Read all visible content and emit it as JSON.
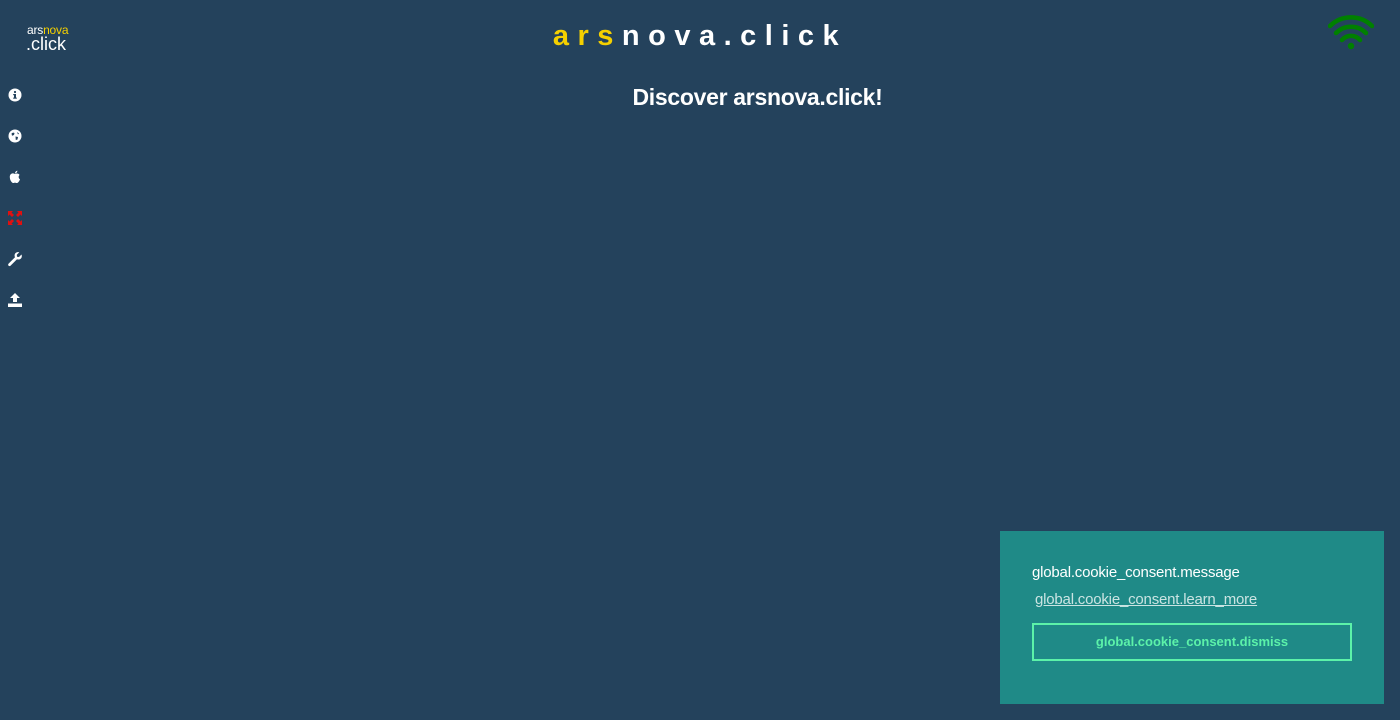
{
  "logo": {
    "top_white": "ars",
    "top_yellow": "nova",
    "bottom": ".click"
  },
  "header": {
    "title_highlight": "ars",
    "title_rest": "nova.click"
  },
  "status": {
    "wifi_icon": "wifi-icon",
    "wifi_color": "#008000"
  },
  "sidebar": {
    "items": [
      {
        "name": "info",
        "icon": "info-icon",
        "color": "#ffffff"
      },
      {
        "name": "globe",
        "icon": "globe-icon",
        "color": "#ffffff"
      },
      {
        "name": "apple",
        "icon": "apple-icon",
        "color": "#ffffff"
      },
      {
        "name": "expand",
        "icon": "expand-icon",
        "color": "#e01010"
      },
      {
        "name": "wrench",
        "icon": "wrench-icon",
        "color": "#ffffff"
      },
      {
        "name": "upload",
        "icon": "upload-icon",
        "color": "#ffffff"
      }
    ]
  },
  "main": {
    "heading": "Discover arsnova.click!"
  },
  "cookie_consent": {
    "message": "global.cookie_consent.message",
    "learn_more": "global.cookie_consent.learn_more",
    "dismiss": "global.cookie_consent.dismiss"
  },
  "colors": {
    "background": "#24425c",
    "accent_yellow": "#f5d000",
    "cookie_background": "#1f8a87",
    "cookie_button": "#5cf2a9"
  }
}
